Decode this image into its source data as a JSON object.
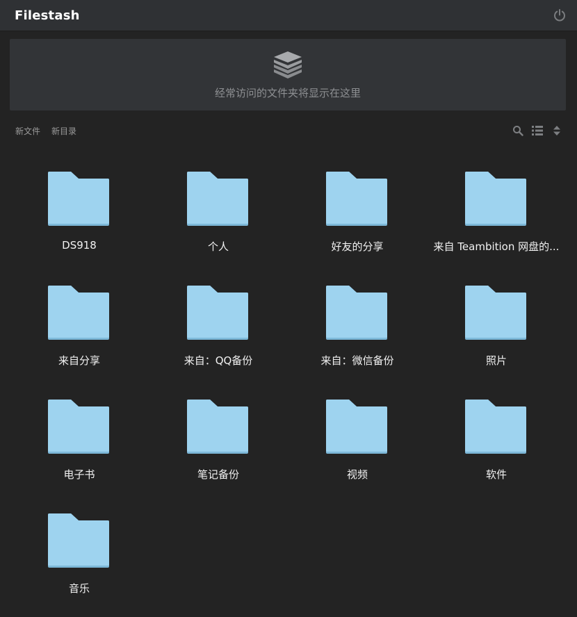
{
  "header": {
    "title": "Filestash"
  },
  "frequent": {
    "message": "经常访问的文件夹将显示在这里"
  },
  "toolbar": {
    "new_file": "新文件",
    "new_dir": "新目录"
  },
  "folders": [
    {
      "name": "DS918"
    },
    {
      "name": "个人"
    },
    {
      "name": "好友的分享"
    },
    {
      "name": "来自 Teambition 网盘的..."
    },
    {
      "name": "来自分享"
    },
    {
      "name": "来自：QQ备份"
    },
    {
      "name": "来自：微信备份"
    },
    {
      "name": "照片"
    },
    {
      "name": "电子书"
    },
    {
      "name": "笔记备份"
    },
    {
      "name": "视频"
    },
    {
      "name": "软件"
    },
    {
      "name": "音乐"
    }
  ],
  "colors": {
    "folder": "#9ed3ef",
    "folder_shadow": "#7db8d8",
    "background": "#232323",
    "topbar": "#2f3134"
  }
}
